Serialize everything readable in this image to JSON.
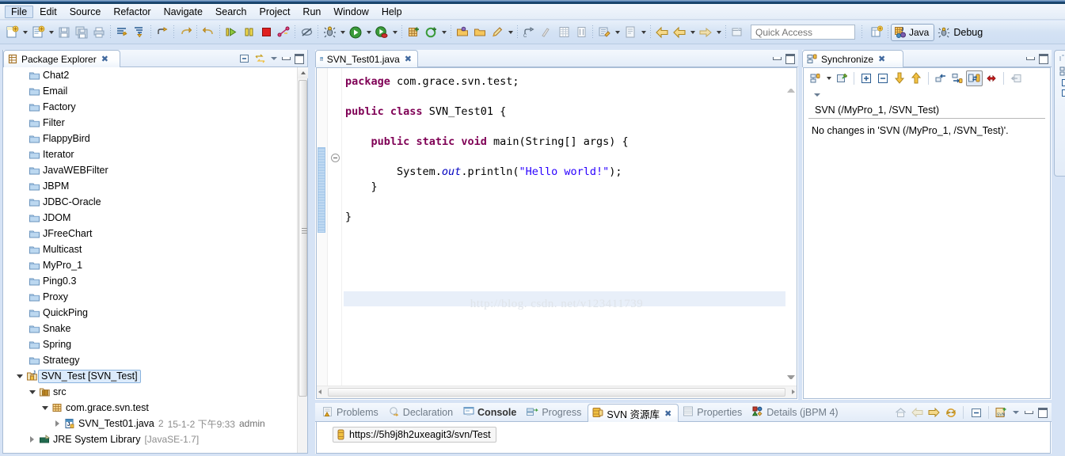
{
  "menu": {
    "items": [
      {
        "label": "File",
        "active": true
      },
      {
        "label": "Edit",
        "active": false
      },
      {
        "label": "Source",
        "active": false
      },
      {
        "label": "Refactor",
        "active": false
      },
      {
        "label": "Navigate",
        "active": false
      },
      {
        "label": "Search",
        "active": false
      },
      {
        "label": "Project",
        "active": false
      },
      {
        "label": "Run",
        "active": false
      },
      {
        "label": "Window",
        "active": false
      },
      {
        "label": "Help",
        "active": false
      }
    ]
  },
  "toolbar": {
    "quick_access_placeholder": "Quick Access",
    "quick_access_value": "",
    "perspective_java": "Java",
    "perspective_debug": "Debug",
    "icons": [
      "new-wizard-icon",
      "new-wizard-dropdown-icon",
      "new-java-project-icon",
      "new-java-dropdown-icon",
      "save-icon",
      "save-all-icon",
      "print-icon",
      "toggle-breadcrumb-icon",
      "open-type-icon",
      "next-annotation-icon",
      "previous-edit-icon",
      "next-edit-icon",
      "resume-icon",
      "suspend-icon",
      "terminate-icon",
      "disconnect-icon",
      "skip-breakpoints-icon",
      "debug-icon",
      "debug-dropdown-icon",
      "run-icon",
      "run-dropdown-icon",
      "coverage-icon",
      "coverage-dropdown-icon",
      "new-jpa-icon",
      "new-ejb-icon",
      "new-ejb-dropdown-icon",
      "open-task-icon",
      "open-folder-icon",
      "edit-task-icon",
      "task-dropdown-icon",
      "toggle-mark-occurrences-icon",
      "ruler-icon",
      "show-whitespace-icon",
      "block-selection-icon",
      "external-tools-icon",
      "external-tools-dropdown-icon",
      "report-icon",
      "report-dropdown-icon",
      "back-icon",
      "forward-icon",
      "forward-dropdown-icon",
      "next-icon",
      "next-dropdown-icon",
      "open-perspective-icon"
    ]
  },
  "package_explorer": {
    "title": "Package Explorer",
    "view_icon": "package-explorer-icon",
    "tools": [
      "collapse-all-icon",
      "link-with-editor-icon",
      "view-menu-icon",
      "minimize-icon",
      "maximize-icon"
    ],
    "items": [
      {
        "label": "Chat2",
        "icon": "folder-icon",
        "indent": 1,
        "twist": "none",
        "type": "project"
      },
      {
        "label": "Email",
        "icon": "folder-icon",
        "indent": 1,
        "twist": "none",
        "type": "project"
      },
      {
        "label": "Factory",
        "icon": "folder-icon",
        "indent": 1,
        "twist": "none",
        "type": "project"
      },
      {
        "label": "Filter",
        "icon": "folder-icon",
        "indent": 1,
        "twist": "none",
        "type": "project"
      },
      {
        "label": "FlappyBird",
        "icon": "folder-icon",
        "indent": 1,
        "twist": "none",
        "type": "project"
      },
      {
        "label": "Iterator",
        "icon": "folder-icon",
        "indent": 1,
        "twist": "none",
        "type": "project"
      },
      {
        "label": "JavaWEBFilter",
        "icon": "folder-icon",
        "indent": 1,
        "twist": "none",
        "type": "project"
      },
      {
        "label": "JBPM",
        "icon": "folder-icon",
        "indent": 1,
        "twist": "none",
        "type": "project"
      },
      {
        "label": "JDBC-Oracle",
        "icon": "folder-icon",
        "indent": 1,
        "twist": "none",
        "type": "project"
      },
      {
        "label": "JDOM",
        "icon": "folder-icon",
        "indent": 1,
        "twist": "none",
        "type": "project"
      },
      {
        "label": "JFreeChart",
        "icon": "folder-icon",
        "indent": 1,
        "twist": "none",
        "type": "project"
      },
      {
        "label": "Multicast",
        "icon": "folder-icon",
        "indent": 1,
        "twist": "none",
        "type": "project"
      },
      {
        "label": "MyPro_1",
        "icon": "folder-icon",
        "indent": 1,
        "twist": "none",
        "type": "project"
      },
      {
        "label": "Ping0.3",
        "icon": "folder-icon",
        "indent": 1,
        "twist": "none",
        "type": "project"
      },
      {
        "label": "Proxy",
        "icon": "folder-icon",
        "indent": 1,
        "twist": "none",
        "type": "project"
      },
      {
        "label": "QuickPing",
        "icon": "folder-icon",
        "indent": 1,
        "twist": "none",
        "type": "project"
      },
      {
        "label": "Snake",
        "icon": "folder-icon",
        "indent": 1,
        "twist": "none",
        "type": "project"
      },
      {
        "label": "Spring",
        "icon": "folder-icon",
        "indent": 1,
        "twist": "none",
        "type": "project"
      },
      {
        "label": "Strategy",
        "icon": "folder-icon",
        "indent": 1,
        "twist": "none",
        "type": "project"
      }
    ],
    "selected_project": "SVN_Test [SVN_Test]",
    "src_label": "src",
    "package_label": "com.grace.svn.test",
    "file_label": "SVN_Test01.java",
    "file_revision": "2",
    "file_date": "15-1-2 下午9:33",
    "file_author": "admin",
    "jre_label": "JRE System Library",
    "jre_version": "[JavaSE-1.7]"
  },
  "editor": {
    "tab_label": "SVN_Test01.java",
    "tab_icon": "java-file-icon",
    "watermark": "http://blog. csdn. net/v123411739",
    "code_lines": [
      {
        "tokens": [
          {
            "t": "package",
            "c": "kw"
          },
          {
            "t": " com.grace.svn.test;",
            "c": ""
          }
        ]
      },
      {
        "tokens": []
      },
      {
        "tokens": [
          {
            "t": "public",
            "c": "kw"
          },
          {
            "t": " ",
            "c": ""
          },
          {
            "t": "class",
            "c": "kw"
          },
          {
            "t": " SVN_Test01 {",
            "c": ""
          }
        ]
      },
      {
        "tokens": []
      },
      {
        "tokens": [
          {
            "t": "    ",
            "c": ""
          },
          {
            "t": "public",
            "c": "kw"
          },
          {
            "t": " ",
            "c": ""
          },
          {
            "t": "static",
            "c": "kw"
          },
          {
            "t": " ",
            "c": ""
          },
          {
            "t": "void",
            "c": "kw"
          },
          {
            "t": " main(String[] args) {",
            "c": ""
          }
        ]
      },
      {
        "tokens": []
      },
      {
        "tokens": [
          {
            "t": "        System.",
            "c": ""
          },
          {
            "t": "out",
            "c": "fld"
          },
          {
            "t": ".println(",
            "c": ""
          },
          {
            "t": "\"Hello world!\"",
            "c": "str"
          },
          {
            "t": ");",
            "c": ""
          }
        ]
      },
      {
        "tokens": [
          {
            "t": "    }",
            "c": ""
          }
        ]
      },
      {
        "tokens": []
      },
      {
        "tokens": [
          {
            "t": "}",
            "c": ""
          }
        ]
      }
    ]
  },
  "synchronize": {
    "title": "Synchronize",
    "view_icon": "synchronize-icon",
    "header": "SVN (/MyPro_1, /SVN_Test)",
    "message": "No changes in 'SVN (/MyPro_1, /SVN_Test)'.",
    "tools": [
      "synchronize-icon",
      "synchronize-dropdown-icon",
      "pin-icon",
      "expand-all-icon",
      "collapse-all-icon",
      "incoming-mode-icon",
      "outgoing-mode-icon",
      "incoming-changes-icon",
      "outgoing-changes-icon",
      "both-mode-icon",
      "conflicts-icon",
      "remove-from-view-icon",
      "view-menu-icon",
      "minimize-icon",
      "maximize-icon"
    ]
  },
  "bottom_panel": {
    "tabs": [
      {
        "label": "Problems",
        "icon": "problems-icon",
        "selected": false,
        "bold": false
      },
      {
        "label": "Declaration",
        "icon": "declaration-icon",
        "selected": false,
        "bold": false
      },
      {
        "label": "Console",
        "icon": "console-icon",
        "selected": false,
        "bold": true
      },
      {
        "label": "Progress",
        "icon": "progress-icon",
        "selected": false,
        "bold": false
      },
      {
        "label": "SVN 资源库",
        "icon": "svn-repository-icon",
        "selected": true,
        "bold": false
      },
      {
        "label": "Properties",
        "icon": "properties-icon",
        "selected": false,
        "bold": false
      },
      {
        "label": "Details (jBPM 4)",
        "icon": "details-icon",
        "selected": false,
        "bold": false
      }
    ],
    "repo_url": "https://5h9j8h2uxeagit3/svn/Test",
    "repo_icon": "svn-repo-node-icon",
    "tools": [
      "home-icon",
      "back-icon",
      "forward-icon",
      "refresh-icon",
      "collapse-all-icon",
      "new-repository-icon",
      "view-menu-icon",
      "minimize-icon",
      "maximize-icon"
    ]
  },
  "colors": {
    "keyword": "#7f0055",
    "string": "#2a00ff",
    "field": "#0000c0",
    "chrome": "#d6e3f5",
    "accent": "#f5c242"
  }
}
